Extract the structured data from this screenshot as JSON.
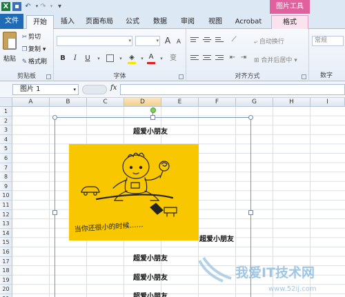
{
  "qat": {
    "logo": "X",
    "context_group": "图片工具"
  },
  "tabs": [
    {
      "label": "文件"
    },
    {
      "label": "开始"
    },
    {
      "label": "插入"
    },
    {
      "label": "页面布局"
    },
    {
      "label": "公式"
    },
    {
      "label": "数据"
    },
    {
      "label": "审阅"
    },
    {
      "label": "视图"
    },
    {
      "label": "Acrobat"
    },
    {
      "label": "格式"
    }
  ],
  "ribbon": {
    "clipboard": {
      "paste": "粘贴",
      "cut": "剪切",
      "copy": "复制 ▾",
      "format_painter": "格式刷",
      "label": "剪贴板"
    },
    "font": {
      "grow": "A",
      "shrink": "A",
      "bold": "B",
      "italic": "I",
      "underline": "U",
      "font_color": "A",
      "phonetic": "变",
      "label": "字体"
    },
    "alignment": {
      "wrap": "自动换行",
      "merge": "合并后居中",
      "label": "对齐方式"
    },
    "number": {
      "format": "常规",
      "label": "数字"
    }
  },
  "formula_bar": {
    "name_box": "图片 1",
    "fx": "fx",
    "content": ""
  },
  "columns": [
    "A",
    "B",
    "C",
    "D",
    "E",
    "F",
    "G",
    "H",
    "I"
  ],
  "rows": [
    "1",
    "2",
    "3",
    "4",
    "5",
    "6",
    "7",
    "8",
    "9",
    "10",
    "11",
    "12",
    "13",
    "14",
    "15",
    "16",
    "17",
    "18",
    "19",
    "20",
    "21"
  ],
  "cells": {
    "d3": "超爱小朋友",
    "f14": "超爱小朋友",
    "d16": "超爱小朋友",
    "d18": "超爱小朋友",
    "d20": "超爱小朋友",
    "d21": "超爱小朋友"
  },
  "picture": {
    "name": "图片 1",
    "caption": "当你还很小的时候……",
    "background": "#f8c700"
  },
  "watermark": {
    "text": "我爱IT技术网",
    "url": "www.52ij.com"
  }
}
